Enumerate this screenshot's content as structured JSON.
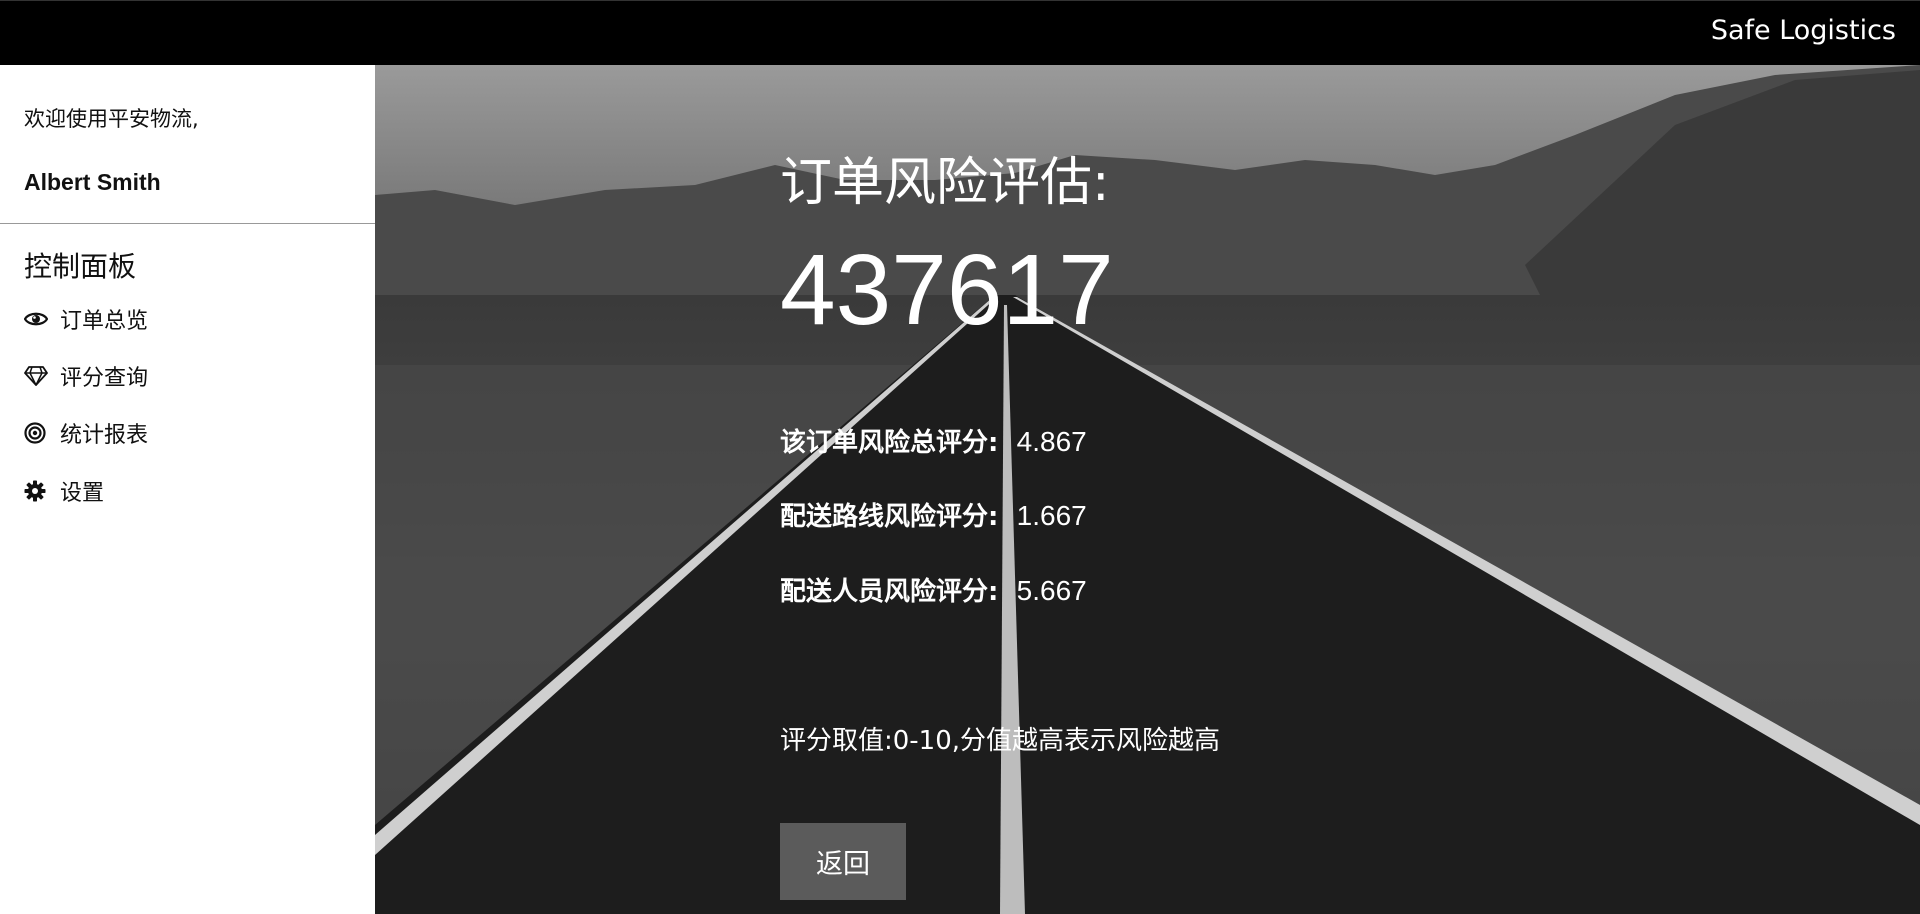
{
  "header": {
    "brand": "Safe Logistics"
  },
  "sidebar": {
    "welcome": "欢迎使用平安物流,",
    "username": "Albert Smith",
    "panel_title": "控制面板",
    "items": [
      {
        "label": "订单总览",
        "icon": "eye-icon"
      },
      {
        "label": "评分查询",
        "icon": "diamond-icon"
      },
      {
        "label": "统计报表",
        "icon": "target-icon"
      },
      {
        "label": "设置",
        "icon": "gear-icon"
      }
    ]
  },
  "main": {
    "title": "订单风险评估:",
    "order_number": "437617",
    "scores": [
      {
        "label": "该订单风险总评分:",
        "value": "4.867"
      },
      {
        "label": "配送路线风险评分:",
        "value": "1.667"
      },
      {
        "label": "配送人员风险评分:",
        "value": "5.667"
      }
    ],
    "note": "评分取值:0-10,分值越高表示风险越高",
    "back_label": "返回"
  }
}
